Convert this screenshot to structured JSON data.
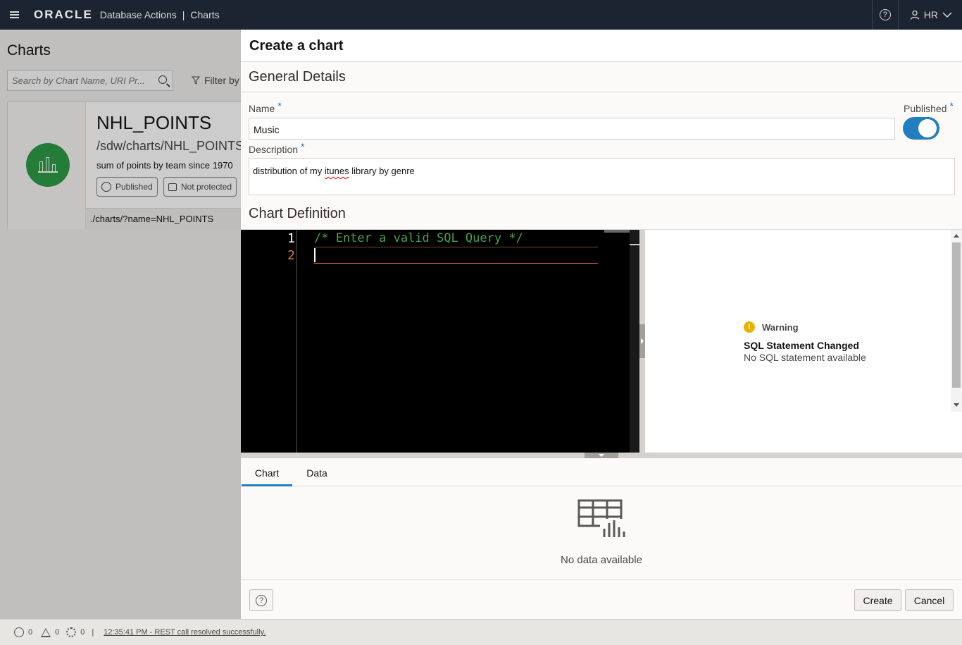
{
  "topbar": {
    "brand": "ORACLE",
    "app_title": "Database Actions",
    "separator": "|",
    "page": "Charts",
    "user": "HR"
  },
  "background": {
    "title": "Charts",
    "search_placeholder": "Search by Chart Name, URI Pr...",
    "filter_label": "Filter by",
    "card": {
      "name": "NHL_POINTS",
      "uri": "/sdw/charts/NHL_POINTS",
      "description": "sum of points by team since 1970",
      "published_label": "Published",
      "protection_label": "Not protected",
      "link": "./charts/?name=NHL_POINTS",
      "icon_color": "#2e9c46"
    }
  },
  "drawer": {
    "title": "Create a chart",
    "general_details": "General Details",
    "name_label": "Name",
    "required_mark": "*",
    "name_value": "Music",
    "published_label": "Published",
    "published_on": true,
    "description_label": "Description",
    "description_value_pre": "distribution of my ",
    "description_value_misspelled": "itunes",
    "description_value_post": " library by genre",
    "chart_definition": "Chart Definition",
    "editor": {
      "lines": [
        "1",
        "2"
      ],
      "code": "/* Enter a valid SQL Query */"
    },
    "preview": {
      "warning_label": "Warning",
      "warning_title": "SQL Statement Changed",
      "warning_message": "No SQL statement available"
    },
    "tabs": [
      "Chart",
      "Data"
    ],
    "active_tab": "Chart",
    "empty_text": "No data available",
    "buttons": {
      "create": "Create",
      "cancel": "Cancel"
    },
    "accent_color": "#227ebe"
  },
  "statusbar": {
    "errors": "0",
    "warnings": "0",
    "tasks": "0",
    "separator": "|",
    "message": "12:35:41 PM - REST call resolved successfully."
  }
}
